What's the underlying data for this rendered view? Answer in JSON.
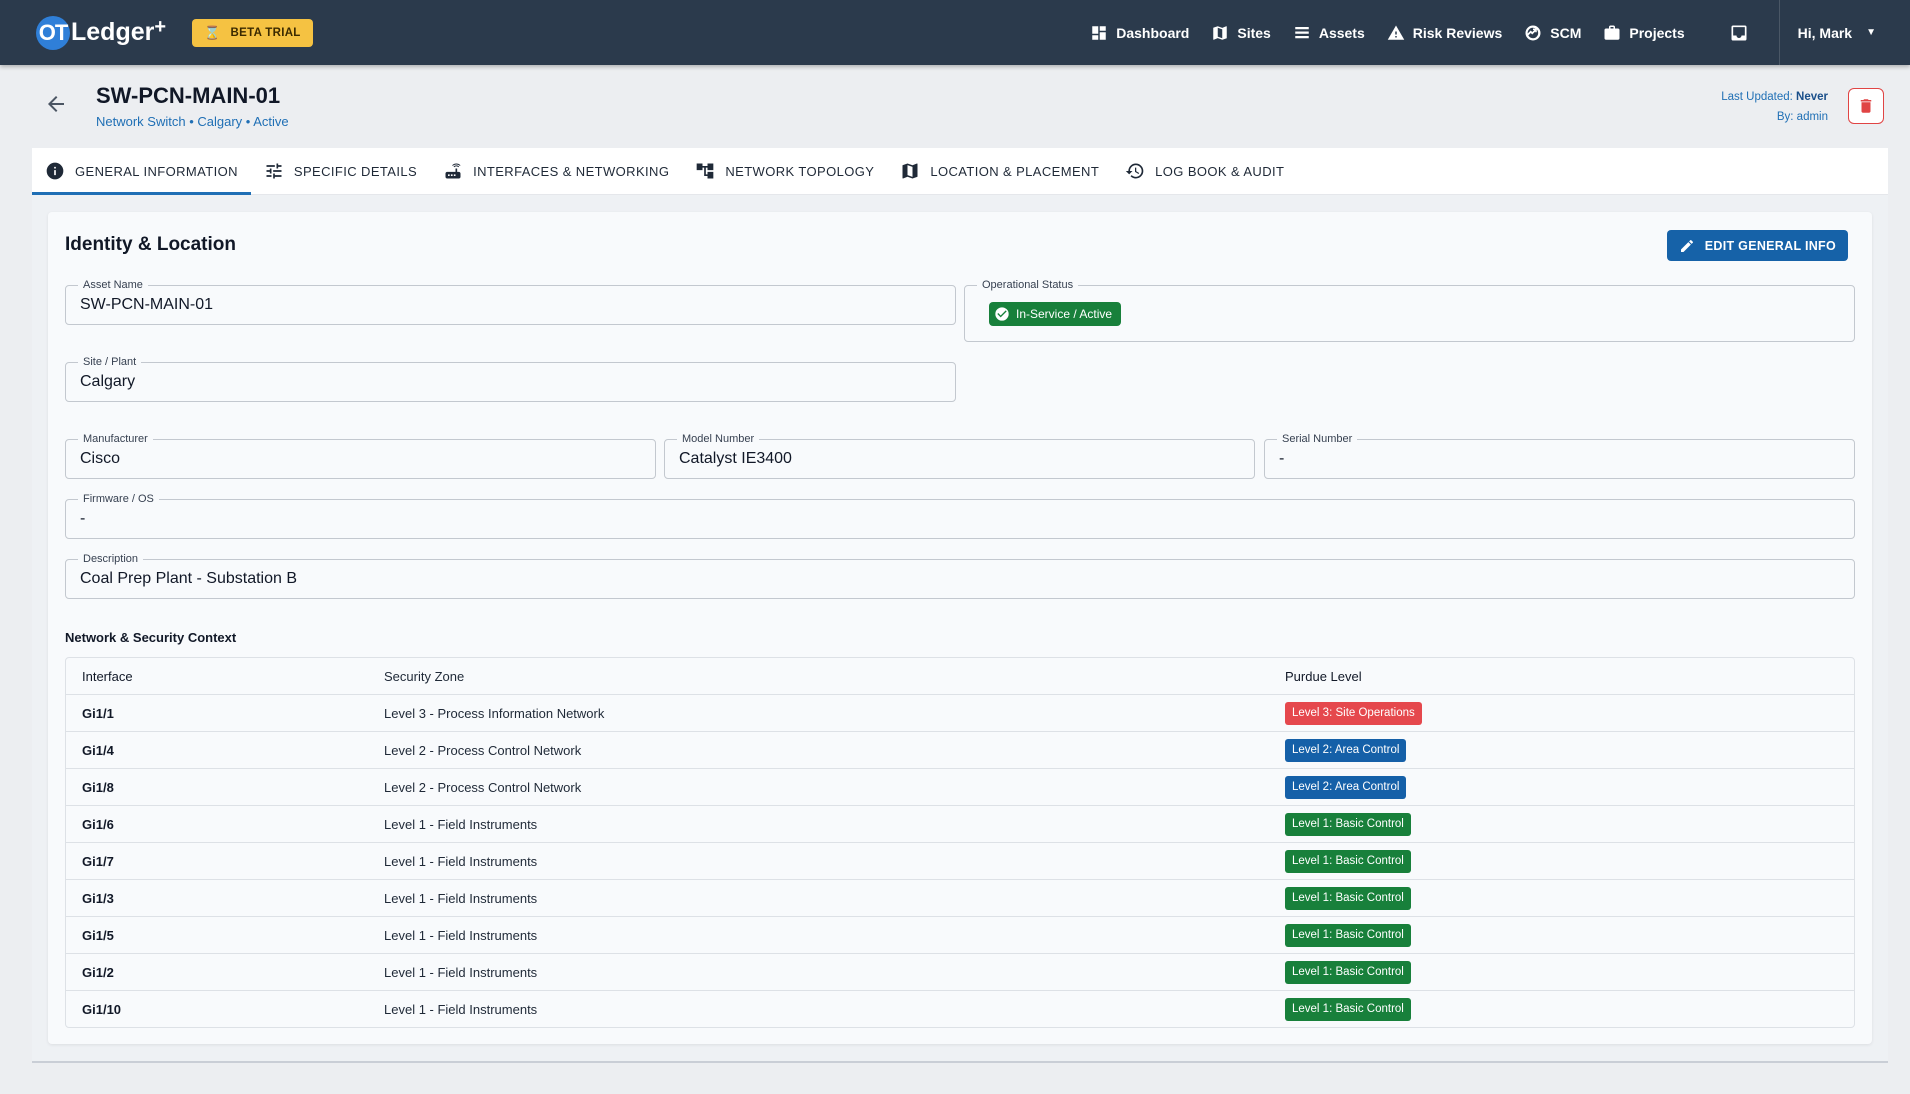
{
  "app": {
    "logo_mark": "OT",
    "logo_text": "Ledger",
    "logo_plus": "+",
    "beta_label": "BETA TRIAL"
  },
  "nav": {
    "items": [
      {
        "label": "Dashboard",
        "icon": "dashboard-icon"
      },
      {
        "label": "Sites",
        "icon": "map-icon"
      },
      {
        "label": "Assets",
        "icon": "list-icon"
      },
      {
        "label": "Risk Reviews",
        "icon": "warning-icon"
      },
      {
        "label": "SCM",
        "icon": "scm-icon"
      },
      {
        "label": "Projects",
        "icon": "briefcase-icon"
      }
    ],
    "user_greeting": "Hi, Mark"
  },
  "header": {
    "title": "SW-PCN-MAIN-01",
    "subtitle": "Network Switch • Calgary • Active",
    "last_updated_label": "Last Updated:",
    "last_updated_value": "Never",
    "by_label": "By:",
    "by_value": "admin"
  },
  "tabs": [
    {
      "label": "GENERAL INFORMATION",
      "active": true
    },
    {
      "label": "SPECIFIC DETAILS",
      "active": false
    },
    {
      "label": "INTERFACES & NETWORKING",
      "active": false
    },
    {
      "label": "NETWORK TOPOLOGY",
      "active": false
    },
    {
      "label": "LOCATION & PLACEMENT",
      "active": false
    },
    {
      "label": "LOG BOOK & AUDIT",
      "active": false
    }
  ],
  "identity": {
    "title": "Identity & Location",
    "edit_button": "EDIT GENERAL INFO",
    "asset_name_label": "Asset Name",
    "asset_name": "SW-PCN-MAIN-01",
    "operational_status_label": "Operational Status",
    "operational_status": "In-Service / Active",
    "site_label": "Site / Plant",
    "site": "Calgary",
    "manufacturer_label": "Manufacturer",
    "manufacturer": "Cisco",
    "model_label": "Model Number",
    "model": "Catalyst IE3400",
    "serial_label": "Serial Number",
    "serial": "-",
    "firmware_label": "Firmware / OS",
    "firmware": "-",
    "description_label": "Description",
    "description": "Coal Prep Plant - Substation B"
  },
  "network": {
    "title": "Network & Security Context",
    "headers": [
      "Interface",
      "Security Zone",
      "Purdue Level"
    ],
    "rows": [
      {
        "interface": "Gi1/1",
        "zone": "Level 3 - Process Information Network",
        "level": "Level 3: Site Operations",
        "color": "#e5484d"
      },
      {
        "interface": "Gi1/4",
        "zone": "Level 2 - Process Control Network",
        "level": "Level 2: Area Control",
        "color": "#1560a8"
      },
      {
        "interface": "Gi1/8",
        "zone": "Level 2 - Process Control Network",
        "level": "Level 2: Area Control",
        "color": "#1560a8"
      },
      {
        "interface": "Gi1/6",
        "zone": "Level 1 - Field Instruments",
        "level": "Level 1: Basic Control",
        "color": "#18803b"
      },
      {
        "interface": "Gi1/7",
        "zone": "Level 1 - Field Instruments",
        "level": "Level 1: Basic Control",
        "color": "#18803b"
      },
      {
        "interface": "Gi1/3",
        "zone": "Level 1 - Field Instruments",
        "level": "Level 1: Basic Control",
        "color": "#18803b"
      },
      {
        "interface": "Gi1/5",
        "zone": "Level 1 - Field Instruments",
        "level": "Level 1: Basic Control",
        "color": "#18803b"
      },
      {
        "interface": "Gi1/2",
        "zone": "Level 1 - Field Instruments",
        "level": "Level 1: Basic Control",
        "color": "#18803b"
      },
      {
        "interface": "Gi1/10",
        "zone": "Level 1 - Field Instruments",
        "level": "Level 1: Basic Control",
        "color": "#18803b"
      }
    ]
  },
  "colors": {
    "topbar": "#2b3a4c",
    "accent": "#1662a8",
    "beta": "#f5c242",
    "danger": "#e04444",
    "success": "#18803b"
  }
}
